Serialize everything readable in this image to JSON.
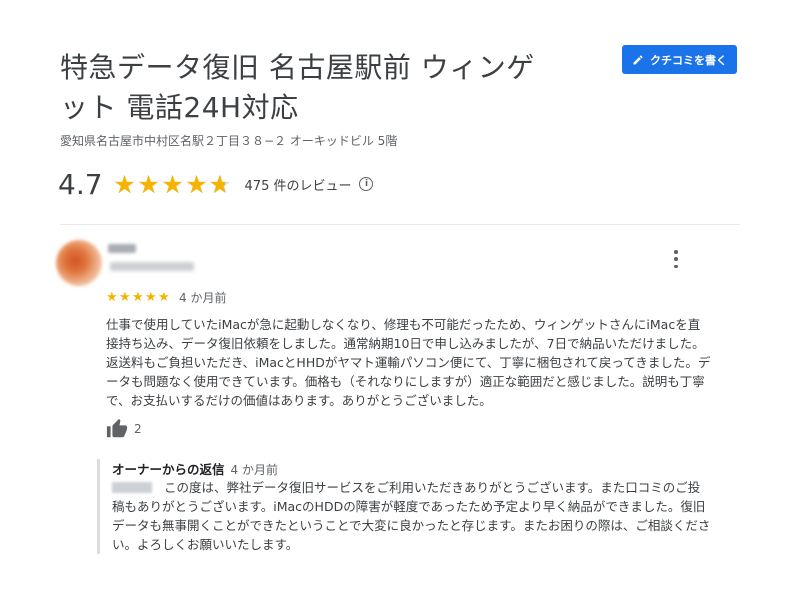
{
  "place": {
    "title": "特急データ復旧 名古屋駅前 ウィンゲット 電話24H対応",
    "address": "愛知県名古屋市中村区名駅２丁目３８−２ オーキッドビル 5階",
    "rating": "4.7",
    "rating_fraction": 0.94,
    "review_count": "475 件のレビュー",
    "write_review_label": "クチコミを書く"
  },
  "review": {
    "stars": 5,
    "time": "4 か月前",
    "text": "仕事で使用していたiMacが急に起動しなくなり、修理も不可能だったため、ウィンゲットさんにiMacを直接持ち込み、データ復旧依頼をしました。通常納期10日で申し込みましたが、7日で納品いただけました。返送料もご負担いただき、iMacとHHDがヤマト運輸パソコン便にて、丁寧に梱包されて戻ってきました。データも問題なく使用できています。価格も（それなりにしますが）適正な範囲だと感じました。説明も丁寧で、お支払いするだけの価値はあります。ありがとうございました。",
    "likes": "2"
  },
  "owner_reply": {
    "label": "オーナーからの返信",
    "time": "4 か月前",
    "text": "この度は、弊社データ復旧サービスをご利用いただきありがとうございます。また口コミのご投稿もありがとうございます。iMacのHDDの障害が軽度であったため予定より早く納品ができました。復旧データも無事開くことができたということで大変に良かったと存じます。またお困りの際は、ご相談ください。よろしくお願いいたします。"
  },
  "colors": {
    "accent": "#1a73e8",
    "star": "#f4b400",
    "muted_text": "#5f6368"
  },
  "icons": {
    "write_review": "pencil-icon",
    "info": "info-icon",
    "more": "more-vert-icon",
    "like": "thumbs-up-icon"
  }
}
